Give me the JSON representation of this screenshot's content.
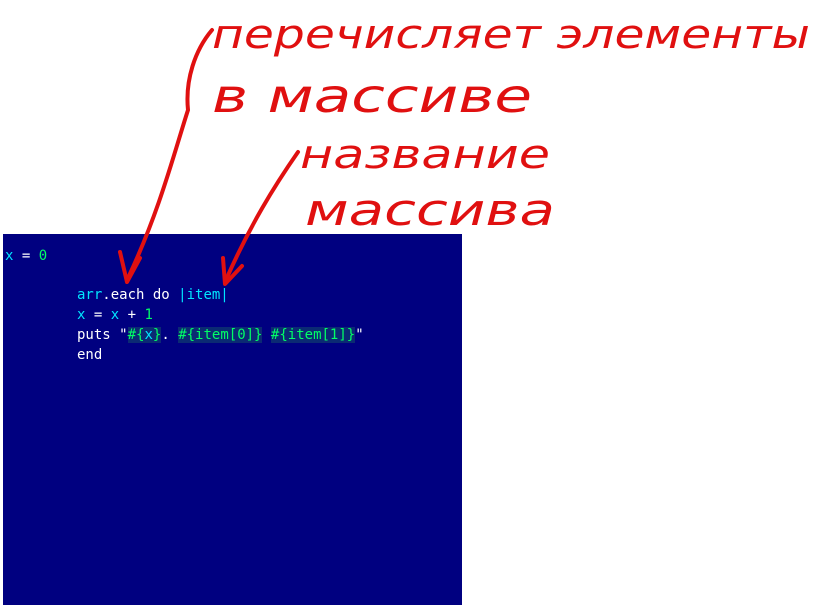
{
  "code": {
    "line1": {
      "var": "x",
      "op": " = ",
      "num": "0"
    },
    "line2": {
      "recv": "arr",
      "method": ".each do ",
      "block_param": "|item|"
    },
    "line3": {
      "var": "x",
      "op1": " = ",
      "var2": "x",
      "op2": " + ",
      "num": "1"
    },
    "line4": {
      "kw": "puts ",
      "q_open": "\"",
      "i1_open": "#{",
      "i1_var": "x",
      "i1_close": "}",
      "sep1": ". ",
      "i2": "#{item[0]}",
      "sep2": " ",
      "i3": "#{item[1]}",
      "q_close": "\""
    },
    "line5": {
      "kw": "end"
    }
  },
  "annotations": {
    "note1_line1": "перечисляет элементы",
    "note1_line2": "в массиве",
    "note2_line1": "название",
    "note2_line2": "массива",
    "color": "#e01010"
  }
}
